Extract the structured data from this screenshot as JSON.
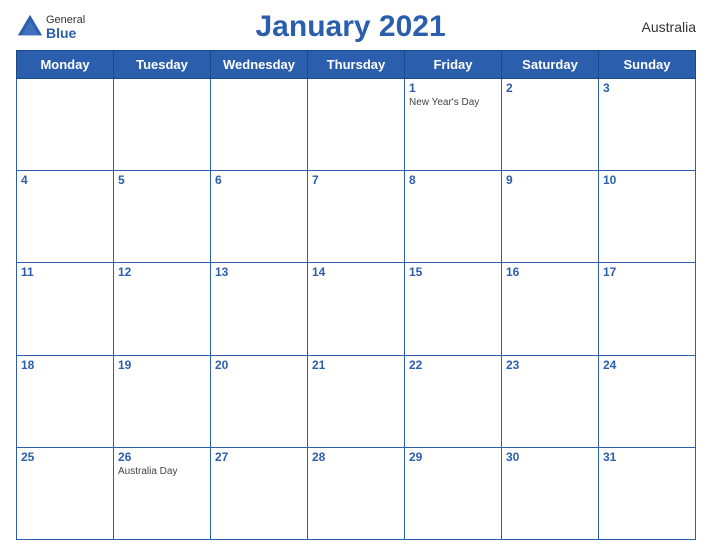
{
  "logo": {
    "general": "General",
    "blue": "Blue"
  },
  "title": "January 2021",
  "country": "Australia",
  "days_of_week": [
    "Monday",
    "Tuesday",
    "Wednesday",
    "Thursday",
    "Friday",
    "Saturday",
    "Sunday"
  ],
  "weeks": [
    [
      {
        "num": "",
        "holiday": ""
      },
      {
        "num": "",
        "holiday": ""
      },
      {
        "num": "",
        "holiday": ""
      },
      {
        "num": "",
        "holiday": ""
      },
      {
        "num": "1",
        "holiday": "New Year's Day"
      },
      {
        "num": "2",
        "holiday": ""
      },
      {
        "num": "3",
        "holiday": ""
      }
    ],
    [
      {
        "num": "4",
        "holiday": ""
      },
      {
        "num": "5",
        "holiday": ""
      },
      {
        "num": "6",
        "holiday": ""
      },
      {
        "num": "7",
        "holiday": ""
      },
      {
        "num": "8",
        "holiday": ""
      },
      {
        "num": "9",
        "holiday": ""
      },
      {
        "num": "10",
        "holiday": ""
      }
    ],
    [
      {
        "num": "11",
        "holiday": ""
      },
      {
        "num": "12",
        "holiday": ""
      },
      {
        "num": "13",
        "holiday": ""
      },
      {
        "num": "14",
        "holiday": ""
      },
      {
        "num": "15",
        "holiday": ""
      },
      {
        "num": "16",
        "holiday": ""
      },
      {
        "num": "17",
        "holiday": ""
      }
    ],
    [
      {
        "num": "18",
        "holiday": ""
      },
      {
        "num": "19",
        "holiday": ""
      },
      {
        "num": "20",
        "holiday": ""
      },
      {
        "num": "21",
        "holiday": ""
      },
      {
        "num": "22",
        "holiday": ""
      },
      {
        "num": "23",
        "holiday": ""
      },
      {
        "num": "24",
        "holiday": ""
      }
    ],
    [
      {
        "num": "25",
        "holiday": ""
      },
      {
        "num": "26",
        "holiday": "Australia Day"
      },
      {
        "num": "27",
        "holiday": ""
      },
      {
        "num": "28",
        "holiday": ""
      },
      {
        "num": "29",
        "holiday": ""
      },
      {
        "num": "30",
        "holiday": ""
      },
      {
        "num": "31",
        "holiday": ""
      }
    ]
  ]
}
